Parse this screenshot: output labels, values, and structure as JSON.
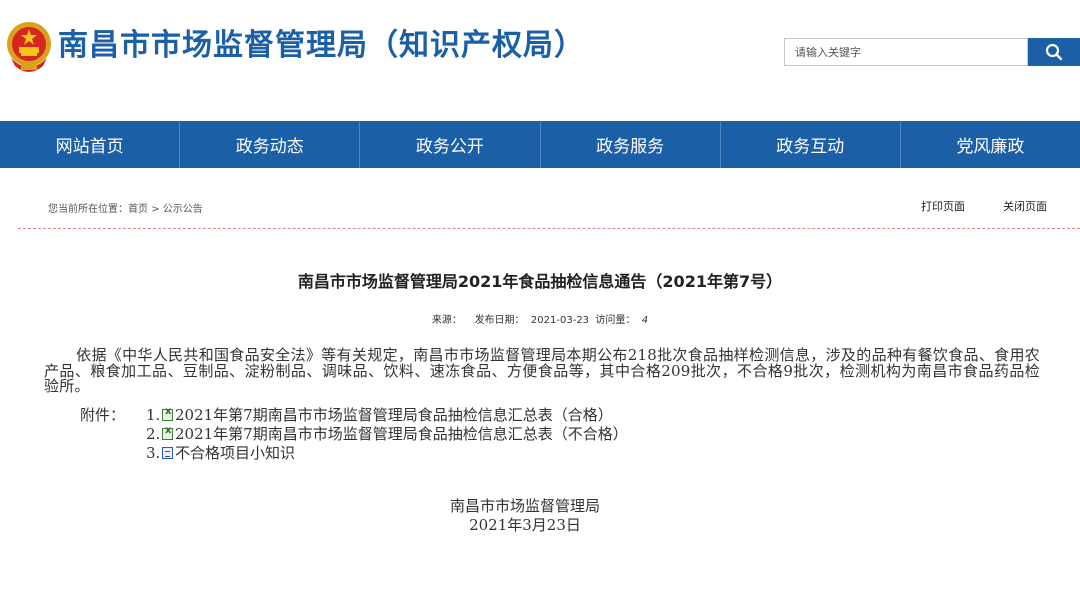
{
  "header": {
    "site_title": "南昌市市场监督管理局（知识产权局）",
    "search_placeholder": "请输入关键字",
    "brand_color": "#1b5fa6"
  },
  "nav": {
    "items": [
      {
        "label": "网站首页"
      },
      {
        "label": "政务动态"
      },
      {
        "label": "政务公开"
      },
      {
        "label": "政务服务"
      },
      {
        "label": "政务互动"
      },
      {
        "label": "党风廉政"
      }
    ]
  },
  "breadcrumb": {
    "prefix": "您当前所在位置：",
    "home": "首页",
    "separator": ">",
    "current": "公示公告"
  },
  "tools": {
    "print": "打印页面",
    "close": "关闭页面"
  },
  "article": {
    "title": "南昌市市场监督管理局2021年食品抽检信息通告（2021年第7号）",
    "meta": {
      "source_label": "来源：",
      "date_label": "发布日期：",
      "date": "2021-03-23",
      "views_label": "访问量：",
      "views": "4"
    },
    "body": "依据《中华人民共和国食品安全法》等有关规定，南昌市市场监督管理局本期公布218批次食品抽样检测信息，涉及的品种有餐饮食品、食用农产品、粮食加工品、豆制品、淀粉制品、调味品、饮料、速冻食品、方便食品等，其中合格209批次，不合格9批次，检测机构为南昌市食品药品检验所。",
    "attachments_label": "附件：",
    "attachments": [
      {
        "num": "1.",
        "icon": "excel-file-icon",
        "text": "2021年第7期南昌市市场监督管理局食品抽检信息汇总表（合格）"
      },
      {
        "num": "2.",
        "icon": "excel-file-icon",
        "text": "2021年第7期南昌市市场监督管理局食品抽检信息汇总表（不合格）"
      },
      {
        "num": "3.",
        "icon": "word-file-icon",
        "text": "不合格项目小知识"
      }
    ],
    "signature": {
      "org": "南昌市市场监督管理局",
      "date": "2021年3月23日"
    }
  }
}
